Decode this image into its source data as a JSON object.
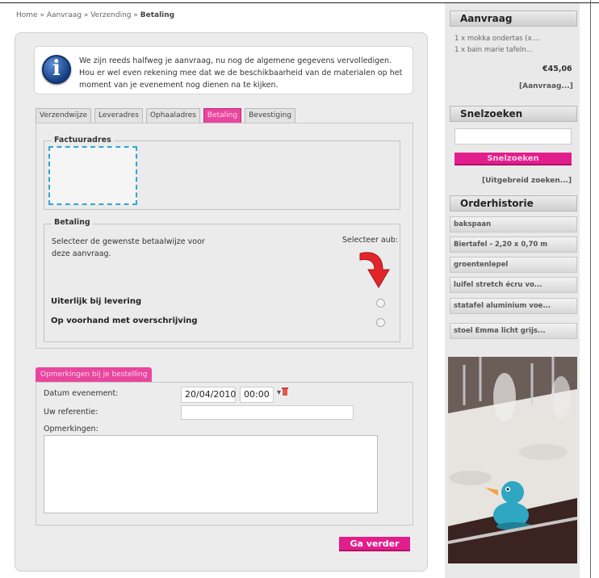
{
  "breadcrumb": {
    "home": "Home",
    "aanvraag": "Aanvraag",
    "verzending": "Verzending",
    "current": "Betaling",
    "sep": " » "
  },
  "info": {
    "text": "We zijn reeds halfweg je aanvraag, nu nog de algemene gegevens vervolledigen. Hou er wel even rekening mee dat we de beschikbaarheid van de materialen op het moment van je evenement nog dienen na te kijken.",
    "icon": "info-icon"
  },
  "tabs": [
    "Verzendwijze",
    "Leveradres",
    "Ophaaladres",
    "Betaling",
    "Bevestiging"
  ],
  "active_tab": "Betaling",
  "factuuradres": {
    "legend": "Factuuradres"
  },
  "betaling": {
    "legend": "Betaling",
    "instruction": "Selecteer de gewenste betaalwijze voor deze aanvraag.",
    "select_label": "Selecteer aub:",
    "options": [
      "Uiterlijk bij levering",
      "Op voorhand met overschrijving"
    ]
  },
  "opmerkingen": {
    "tab_label": "Opmerkingen bij je bestelling",
    "datum_label": "Datum evenement:",
    "datum_value": "20/04/2010",
    "time_value": "00:00",
    "time_arrow": "▾",
    "referentie_label": "Uw referentie:",
    "referentie_value": "",
    "opmerkingen_label": "Opmerkingen:"
  },
  "go_button": "Ga verder",
  "sidebar": {
    "aanvraag": {
      "title": "Aanvraag",
      "items": [
        "1 x mokka ondertas (x....",
        "1 x bain marie tafeln..."
      ],
      "total": "€45,06",
      "link": "[Aanvraag...]"
    },
    "snelzoeken": {
      "title": "Snelzoeken",
      "button": "Snelzoeken",
      "link": "[Uitgebreid zoeken...]"
    },
    "orderhistorie": {
      "title": "Orderhistorie",
      "items": [
        "bakspaan",
        "Biertafel - 2,20 x 0,70 m",
        "groentenlepel",
        "luifel stretch écru vo...",
        "statafel aluminium voe...",
        "stoel Emma licht grijs..."
      ]
    }
  },
  "colors": {
    "accent": "#e21d8c",
    "tab_active": "#e9469f",
    "info_blue": "#1f4f9b",
    "arrow_red": "#e0262b",
    "dashed": "#2ea8d0"
  }
}
